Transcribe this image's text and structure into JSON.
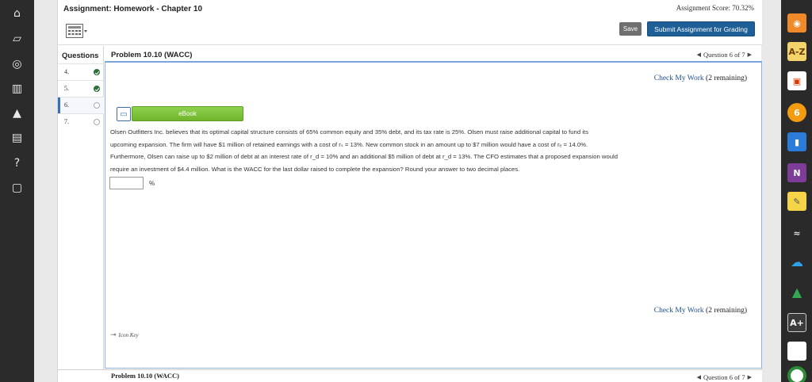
{
  "header": {
    "assignment_title": "Assignment: Homework - Chapter 10",
    "assignment_score": "Assignment Score: 70.32%",
    "save_label": "Save",
    "submit_label": "Submit Assignment for Grading"
  },
  "questions_nav": {
    "title": "Questions",
    "items": [
      {
        "num": "4.",
        "status": "done"
      },
      {
        "num": "5.",
        "status": "done"
      },
      {
        "num": "6.",
        "status": "open",
        "current": true
      },
      {
        "num": "7.",
        "status": "open"
      }
    ]
  },
  "problem": {
    "title": "Problem 10.10 (WACC)",
    "pager": {
      "label": "Question 6 of 7"
    },
    "check_work": {
      "link": "Check My Work",
      "remaining": "(2 remaining)"
    },
    "ebook_label": "eBook",
    "text_line1": "Olsen Outfitters Inc. believes that its optimal capital structure consists of 65% common equity and 35% debt, and its tax rate is 25%. Olsen must raise additional capital to fund its",
    "text_line2": "upcoming expansion. The firm will have $1 million of retained earnings with a cost of rₛ = 13%. New common stock in an amount up to $7 million would have a cost of rₑ = 14.0%.",
    "text_line3": "Furthermore, Olsen can raise up to $2 million of debt at an interest rate of r_d = 10% and an additional $5 million of debt at r_d = 13%. The CFO estimates that a proposed expansion would",
    "text_line4": "require an investment of $4.4 million. What is the WACC for the last dollar raised to complete the expansion? Round your answer to two decimal places.",
    "answer_value": "",
    "answer_unit": "%",
    "icon_key": "Icon Key"
  },
  "left_bar_icons": [
    "home-icon",
    "cards-icon",
    "compass-icon",
    "book-icon",
    "graduation-cap-icon",
    "briefcase-icon",
    "help-icon",
    "feedback-icon"
  ],
  "right_bar_icons": [
    "rss-icon",
    "az-icon",
    "office-icon",
    "six-icon",
    "book-app-icon",
    "onenote-icon",
    "note-icon",
    "wifi-icon",
    "cloud-icon",
    "drive-icon",
    "grade-icon",
    "card-icon",
    "circle-icon"
  ],
  "colors": {
    "accent_blue": "#1f5f97",
    "ebook_green": "#7dc43a",
    "done_green": "#2f6f3a"
  }
}
